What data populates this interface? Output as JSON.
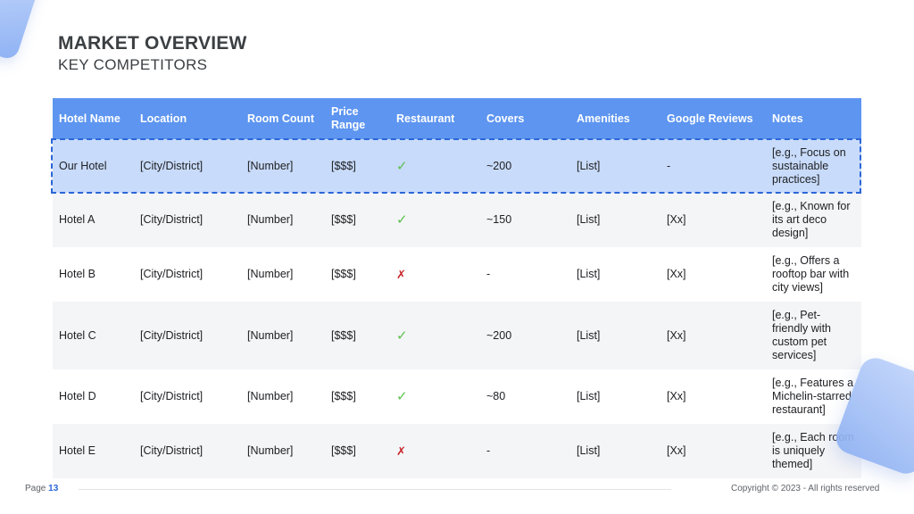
{
  "header": {
    "title": "MARKET OVERVIEW",
    "subtitle": "KEY COMPETITORS"
  },
  "table": {
    "columns": [
      "Hotel Name",
      "Location",
      "Room Count",
      "Price Range",
      "Restaurant",
      "Covers",
      "Amenities",
      "Google Reviews",
      "Notes"
    ],
    "rows": [
      {
        "name": "Our Hotel",
        "location": "[City/District]",
        "rooms": "[Number]",
        "price": "[$$$]",
        "restaurant": "✓",
        "covers": "~200",
        "amenities": "[List]",
        "reviews": "-",
        "notes": "[e.g., Focus on sustainable practices]"
      },
      {
        "name": "Hotel A",
        "location": "[City/District]",
        "rooms": "[Number]",
        "price": "[$$$]",
        "restaurant": "✓",
        "covers": "~150",
        "amenities": "[List]",
        "reviews": "[Xx]",
        "notes": "[e.g., Known for its art deco design]"
      },
      {
        "name": "Hotel B",
        "location": "[City/District]",
        "rooms": "[Number]",
        "price": "[$$$]",
        "restaurant": "✗",
        "covers": "-",
        "amenities": "[List]",
        "reviews": "[Xx]",
        "notes": "[e.g., Offers a rooftop bar with city views]"
      },
      {
        "name": "Hotel C",
        "location": "[City/District]",
        "rooms": "[Number]",
        "price": "[$$$]",
        "restaurant": "✓",
        "covers": "~200",
        "amenities": "[List]",
        "reviews": "[Xx]",
        "notes": "[e.g., Pet-friendly with custom pet services]"
      },
      {
        "name": "Hotel D",
        "location": "[City/District]",
        "rooms": "[Number]",
        "price": "[$$$]",
        "restaurant": "✓",
        "covers": "~80",
        "amenities": "[List]",
        "reviews": "[Xx]",
        "notes": "[e.g., Features a Michelin-starred restaurant]"
      },
      {
        "name": "Hotel E",
        "location": "[City/District]",
        "rooms": "[Number]",
        "price": "[$$$]",
        "restaurant": "✗",
        "covers": "-",
        "amenities": "[List]",
        "reviews": "[Xx]",
        "notes": "[e.g., Each room is uniquely themed]"
      }
    ]
  },
  "footer": {
    "page_label": "Page",
    "page_number": "13",
    "copyright": "Copyright © 2023 - All rights reserved"
  },
  "colors": {
    "header_bg": "#5d95f0",
    "highlight_bg": "#c8dbfa",
    "highlight_border": "#2a66d8",
    "check": "#5cc050",
    "cross": "#c8262a"
  }
}
